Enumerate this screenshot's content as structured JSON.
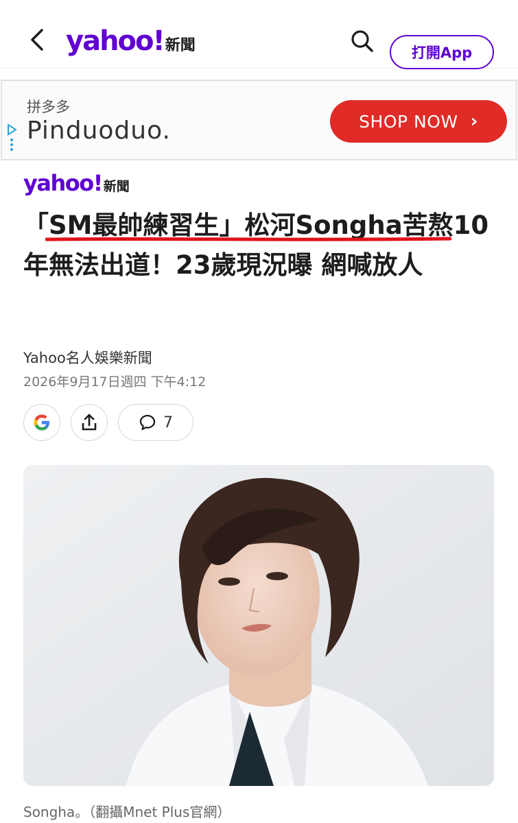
{
  "topbar": {
    "logo_word": "yahoo!",
    "logo_section": "新聞",
    "open_app_label": "打開App"
  },
  "ad": {
    "brand_small": "拼多多",
    "brand_name": "Pinduoduo.",
    "cta_label": "SHOP NOW",
    "cta_color": "#e02b27"
  },
  "article": {
    "source_logo_word": "yahoo!",
    "source_logo_section": "新聞",
    "headline": "「SM最帥練習生」松河Songha苦熬10年無法出道！23歲現況曝 網喊放人",
    "author": "Yahoo名人娛樂新聞",
    "date": "2026年9月17日週四 下午4:12",
    "comment_count": "7",
    "image_caption": "Songha。（翻攝Mnet Plus官網）"
  },
  "colors": {
    "brand_purple": "#6001d2",
    "highlight_underline": "#e0121b"
  }
}
